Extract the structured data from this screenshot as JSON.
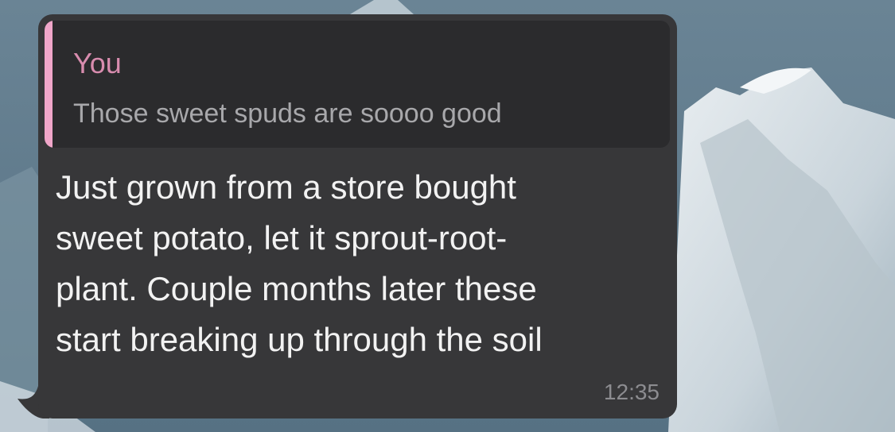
{
  "chat": {
    "message": {
      "reply": {
        "sender": "You",
        "text": "Those sweet spuds are soooo good"
      },
      "lines": [
        "Just grown from a store bought",
        "sweet potato, let it sprout-root-",
        "plant. Couple months later these",
        "start breaking up through the soil"
      ],
      "time": "12:35"
    }
  },
  "colors": {
    "bubble": "#373739",
    "quote_background": "#2b2b2d",
    "quote_accent": "#f0a6c9",
    "quote_sender": "#d88cae"
  }
}
